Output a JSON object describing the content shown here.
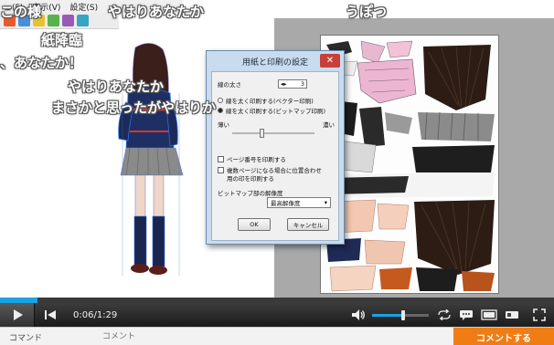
{
  "app": {
    "menu": [
      {
        "label": "ェ(F)"
      },
      {
        "label": "表示(V)"
      },
      {
        "label": "設定(S)"
      }
    ]
  },
  "dialog": {
    "title": "用紙と印刷の設定",
    "close_glyph": "✕",
    "line_width_label": "線の太さ",
    "line_width_value": "3",
    "opt_vector": "線を太く印刷する(ベクター印刷)",
    "opt_bitmap": "線を太く印刷する(ビットマップ印刷)",
    "light_label": "薄い",
    "dark_label": "濃い",
    "print_page_numbers": "ページ番号を印刷する",
    "multi_page_line1": "複数ページになる場合に位置合わせ",
    "multi_page_line2": "用の印を印刷する",
    "bitmap_res_label": "ビットマップ部の解像度",
    "bitmap_res_value": "最高解像度",
    "ok": "OK",
    "cancel": "キャンセル"
  },
  "danmaku": [
    {
      "text": "この様"
    },
    {
      "text": "やはりあなたか"
    },
    {
      "text": "うぽつ"
    },
    {
      "text": "紙降臨"
    },
    {
      "text": "、あなたか！"
    },
    {
      "text": "やはりあなたか"
    },
    {
      "text": "まさかと思ったがやはりか"
    }
  ],
  "player": {
    "time": "0:06/1:29",
    "progress": 0.067,
    "volume": 0.55
  },
  "comment_bar": {
    "label": "コマンド",
    "placeholder": "コメント",
    "submit": "コメントする"
  },
  "colors": {
    "accent_blue": "#1aa3e4",
    "submit_orange": "#f07d14",
    "dialog_frame": "#c9dcef",
    "close_red": "#c7403a"
  }
}
